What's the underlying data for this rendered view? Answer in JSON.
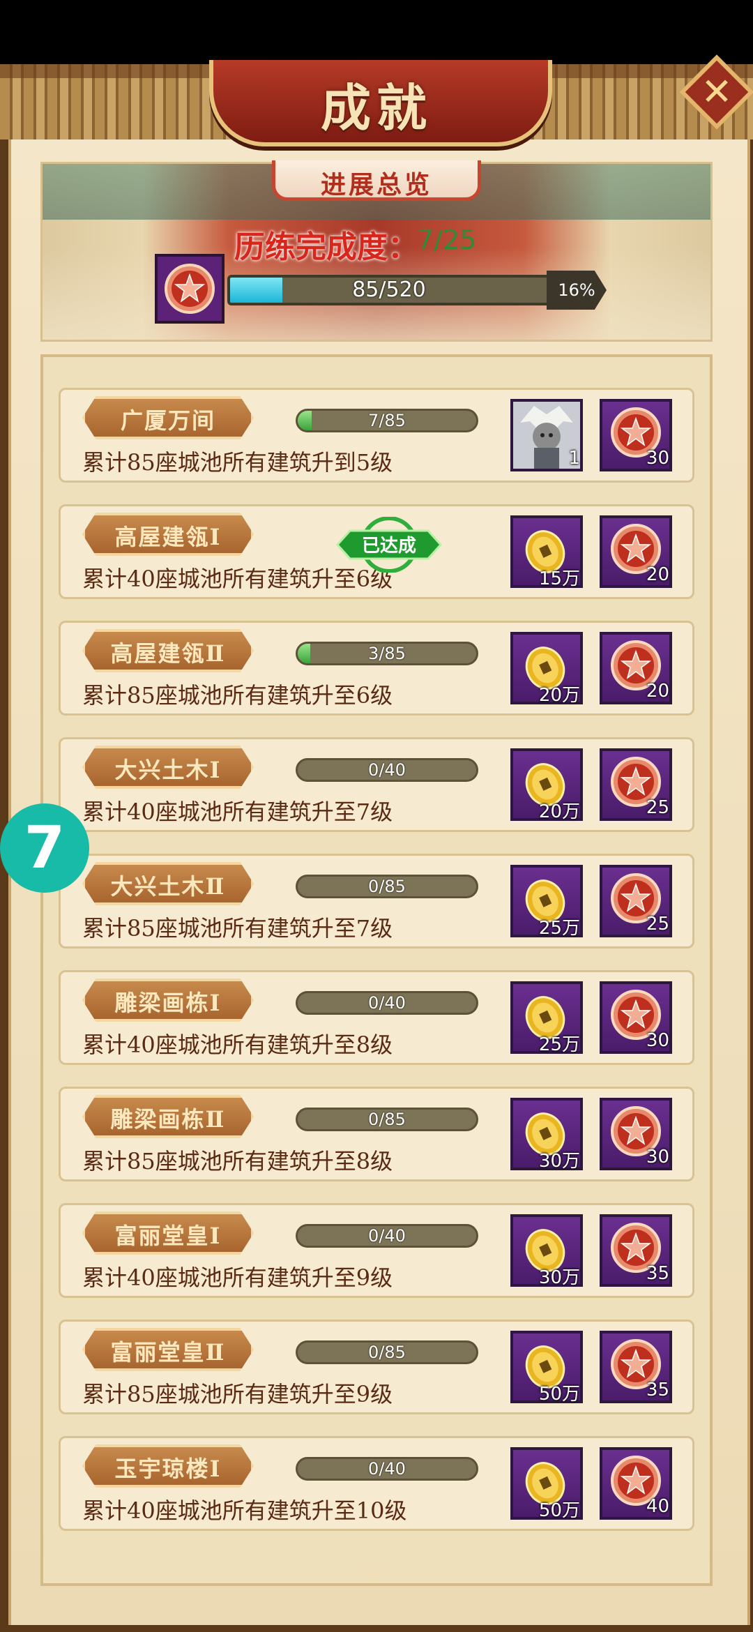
{
  "title": "成就",
  "close_icon": "close-icon",
  "overview": {
    "tab_label": "进展总览",
    "label": "历练完成度：",
    "count": "7/25",
    "bar_value": 85,
    "bar_max": 520,
    "bar_text": "85/520",
    "percent": "16%"
  },
  "achievements": [
    {
      "title": "广厦万间",
      "desc": "累计85座城池所有建筑升到5级",
      "progress": "7/85",
      "fraction": 0.08,
      "rewards": [
        {
          "icon": "hero-portrait",
          "label": "1"
        },
        {
          "icon": "star-medal-icon",
          "label": "30"
        }
      ]
    },
    {
      "title": "高屋建瓴Ⅰ",
      "desc": "累计40座城池所有建筑升至6级",
      "badge": "已达成",
      "rewards": [
        {
          "icon": "gold-coin-icon",
          "label": "15万"
        },
        {
          "icon": "star-medal-icon",
          "label": "20"
        }
      ]
    },
    {
      "title": "高屋建瓴Ⅱ",
      "desc": "累计85座城池所有建筑升至6级",
      "progress": "3/85",
      "fraction": 0.035,
      "rewards": [
        {
          "icon": "gold-coin-icon",
          "label": "20万"
        },
        {
          "icon": "star-medal-icon",
          "label": "20"
        }
      ]
    },
    {
      "title": "大兴土木Ⅰ",
      "desc": "累计40座城池所有建筑升至7级",
      "progress": "0/40",
      "fraction": 0,
      "rewards": [
        {
          "icon": "gold-coin-icon",
          "label": "20万"
        },
        {
          "icon": "star-medal-icon",
          "label": "25"
        }
      ]
    },
    {
      "title": "大兴土木Ⅱ",
      "desc": "累计85座城池所有建筑升至7级",
      "progress": "0/85",
      "fraction": 0,
      "rewards": [
        {
          "icon": "gold-coin-icon",
          "label": "25万"
        },
        {
          "icon": "star-medal-icon",
          "label": "25"
        }
      ]
    },
    {
      "title": "雕梁画栋Ⅰ",
      "desc": "累计40座城池所有建筑升至8级",
      "progress": "0/40",
      "fraction": 0,
      "rewards": [
        {
          "icon": "gold-coin-icon",
          "label": "25万"
        },
        {
          "icon": "star-medal-icon",
          "label": "30"
        }
      ]
    },
    {
      "title": "雕梁画栋Ⅱ",
      "desc": "累计85座城池所有建筑升至8级",
      "progress": "0/85",
      "fraction": 0,
      "rewards": [
        {
          "icon": "gold-coin-icon",
          "label": "30万"
        },
        {
          "icon": "star-medal-icon",
          "label": "30"
        }
      ]
    },
    {
      "title": "富丽堂皇Ⅰ",
      "desc": "累计40座城池所有建筑升至9级",
      "progress": "0/40",
      "fraction": 0,
      "rewards": [
        {
          "icon": "gold-coin-icon",
          "label": "30万"
        },
        {
          "icon": "star-medal-icon",
          "label": "35"
        }
      ]
    },
    {
      "title": "富丽堂皇Ⅱ",
      "desc": "累计85座城池所有建筑升至9级",
      "progress": "0/85",
      "fraction": 0,
      "rewards": [
        {
          "icon": "gold-coin-icon",
          "label": "50万"
        },
        {
          "icon": "star-medal-icon",
          "label": "35"
        }
      ]
    },
    {
      "title": "玉宇琼楼Ⅰ",
      "desc": "累计40座城池所有建筑升至10级",
      "progress": "0/40",
      "fraction": 0,
      "rewards": [
        {
          "icon": "gold-coin-icon",
          "label": "50万"
        },
        {
          "icon": "star-medal-icon",
          "label": "40"
        }
      ]
    }
  ],
  "scroll_icon": "chevron-down-icon",
  "floating_badge": "7"
}
